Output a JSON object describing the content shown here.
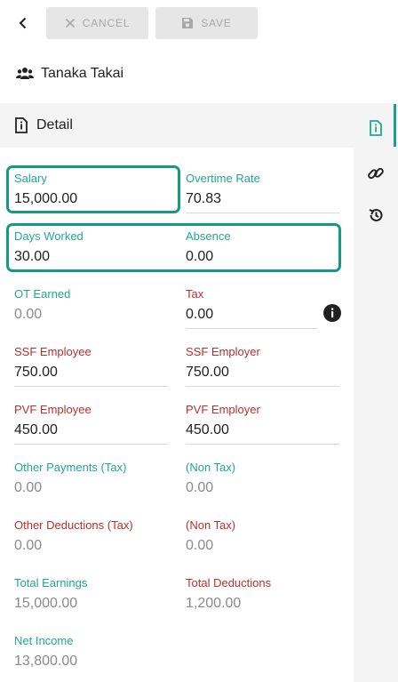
{
  "toolbar": {
    "cancel_label": "CANCEL",
    "save_label": "SAVE"
  },
  "person": {
    "name": "Tanaka Takai"
  },
  "section": {
    "title": "Detail"
  },
  "fields": {
    "salary": {
      "label": "Salary",
      "value": "15,000.00"
    },
    "overtime_rate": {
      "label": "Overtime Rate",
      "value": "70.83"
    },
    "days_worked": {
      "label": "Days Worked",
      "value": "30.00"
    },
    "absence": {
      "label": "Absence",
      "value": "0.00"
    },
    "ot_earned": {
      "label": "OT Earned",
      "value": "0.00"
    },
    "tax": {
      "label": "Tax",
      "value": "0.00"
    },
    "ssf_employee": {
      "label": "SSF Employee",
      "value": "750.00"
    },
    "ssf_employer": {
      "label": "SSF Employer",
      "value": "750.00"
    },
    "pvf_employee": {
      "label": "PVF Employee",
      "value": "450.00"
    },
    "pvf_employer": {
      "label": "PVF Employer",
      "value": "450.00"
    },
    "other_payments_tax": {
      "label": "Other Payments (Tax)",
      "value": "0.00"
    },
    "other_payments_non_tax": {
      "label": "(Non Tax)",
      "value": "0.00"
    },
    "other_deductions_tax": {
      "label": "Other Deductions (Tax)",
      "value": "0.00"
    },
    "other_deductions_non_tax": {
      "label": "(Non Tax)",
      "value": "0.00"
    },
    "total_earnings": {
      "label": "Total Earnings",
      "value": "15,000.00"
    },
    "total_deductions": {
      "label": "Total Deductions",
      "value": "1,200.00"
    },
    "net_income": {
      "label": "Net Income",
      "value": "13,800.00"
    }
  },
  "icons": {
    "back": "arrow-left-icon",
    "cancel": "close-icon",
    "save": "floppy-disk-icon",
    "person": "users-icon",
    "section": "info-document-icon",
    "rail": [
      "info-document-icon",
      "link-icon",
      "history-icon"
    ],
    "tax_info": "info-circle-icon"
  },
  "colors": {
    "accent": "#21a88f",
    "highlight": "#149b7f",
    "deduction_label": "#b5312f",
    "disabled_button": "#e6e6e6"
  }
}
